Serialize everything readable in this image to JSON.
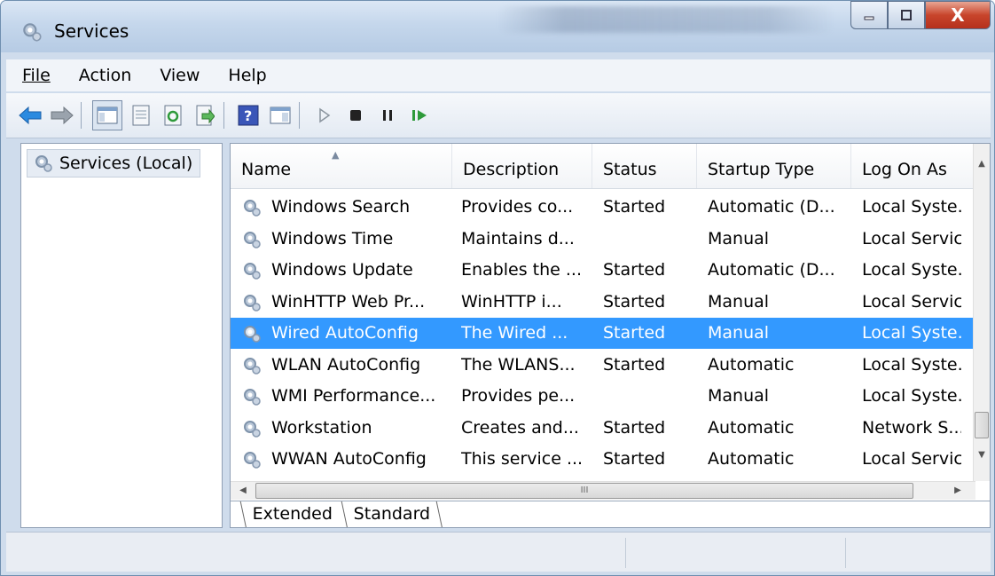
{
  "window": {
    "title": "Services",
    "close_glyph": "X"
  },
  "menu": [
    {
      "label": "File"
    },
    {
      "label": "Action"
    },
    {
      "label": "View"
    },
    {
      "label": "Help"
    }
  ],
  "toolbar_icons": [
    "back-arrow-icon",
    "forward-arrow-icon",
    "show-console-tree-icon",
    "properties-icon",
    "refresh-icon",
    "export-list-icon",
    "help-icon",
    "show-action-pane-icon",
    "start-service-icon",
    "stop-service-icon",
    "pause-service-icon",
    "restart-service-icon"
  ],
  "tree": {
    "root_label": "Services (Local)"
  },
  "table": {
    "columns": [
      "Name",
      "Description",
      "Status",
      "Startup Type",
      "Log On As"
    ],
    "rows": [
      {
        "name": "Windows Search",
        "description": "Provides co...",
        "status": "Started",
        "startup": "Automatic (D...",
        "logon": "Local Syste..."
      },
      {
        "name": "Windows Time",
        "description": "Maintains d...",
        "status": "",
        "startup": "Manual",
        "logon": "Local Servic"
      },
      {
        "name": "Windows Update",
        "description": "Enables the ...",
        "status": "Started",
        "startup": "Automatic (D...",
        "logon": "Local Syste..."
      },
      {
        "name": "WinHTTP Web Pr...",
        "description": "WinHTTP i...",
        "status": "Started",
        "startup": "Manual",
        "logon": "Local Servic"
      },
      {
        "name": "Wired AutoConfig",
        "description": "The Wired ...",
        "status": "Started",
        "startup": "Manual",
        "logon": "Local Syste..."
      },
      {
        "name": "WLAN AutoConfig",
        "description": "The WLANS...",
        "status": "Started",
        "startup": "Automatic",
        "logon": "Local Syste..."
      },
      {
        "name": "WMI Performance...",
        "description": "Provides pe...",
        "status": "",
        "startup": "Manual",
        "logon": "Local Syste..."
      },
      {
        "name": "Workstation",
        "description": "Creates and...",
        "status": "Started",
        "startup": "Automatic",
        "logon": "Network S..."
      },
      {
        "name": "WWAN AutoConfig",
        "description": "This service ...",
        "status": "Started",
        "startup": "Automatic",
        "logon": "Local Servic"
      }
    ],
    "selected_row": 4,
    "hscroll_grip": "III"
  },
  "tabs": [
    {
      "label": "Extended"
    },
    {
      "label": "Standard"
    }
  ],
  "colors": {
    "selection": "#3399ff",
    "accent": "#c8452c"
  }
}
